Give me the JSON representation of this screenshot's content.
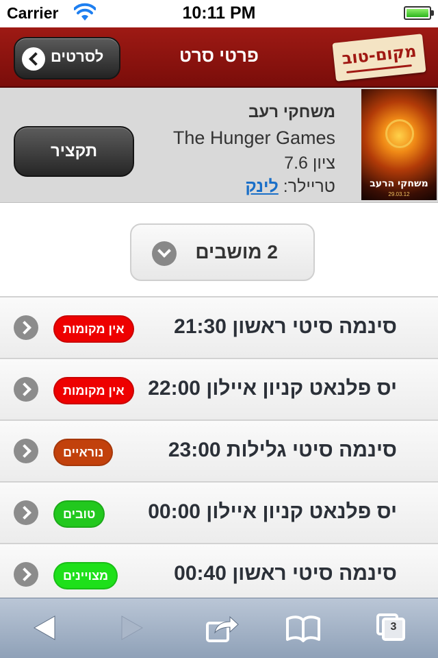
{
  "status_bar": {
    "carrier": "Carrier",
    "time": "10:11 PM",
    "battery_level": 1.0
  },
  "header": {
    "back_label": "לסרטים",
    "title": "פרטי סרט",
    "logo_text": "מקום-טוב"
  },
  "movie": {
    "title_hebrew": "משחקי רעב",
    "title_english": "The Hunger Games",
    "rating": "ציון 7.6",
    "trailer_label": "טריילר:",
    "trailer_link": "לינק",
    "summary_button": "תקציר",
    "poster_title": "משחקי הרעב",
    "poster_date": "29.03.12"
  },
  "seats": {
    "label": "2 מושבים"
  },
  "screenings": [
    {
      "text": "סינמה סיטי ראשון 21:30",
      "badge": "אין מקומות",
      "badge_color": "#ee0000"
    },
    {
      "text": "יס פלנאט קניון איילון 22:00",
      "badge": "אין מקומות",
      "badge_color": "#ee0000"
    },
    {
      "text": "סינמה סיטי גלילות 23:00",
      "badge": "נוראיים",
      "badge_color": "#c2410c"
    },
    {
      "text": "יס פלנאט קניון איילון 00:00",
      "badge": "טובים",
      "badge_color": "#22c81e"
    },
    {
      "text": "סינמה סיטי ראשון 00:40",
      "badge": "מצויינים",
      "badge_color": "#1ee01a"
    }
  ],
  "toolbar": {
    "tab_count": "3"
  }
}
